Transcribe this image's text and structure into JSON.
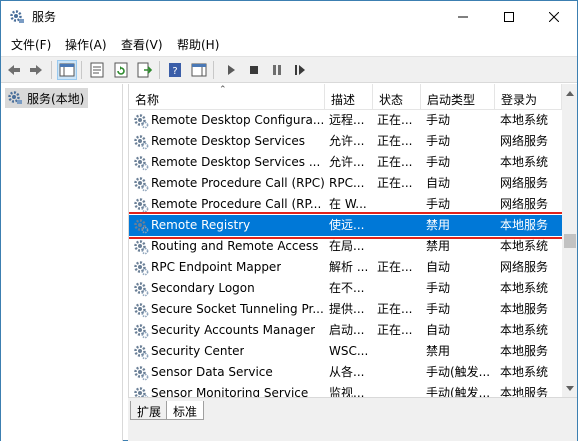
{
  "window": {
    "title": "服务",
    "icon": "gear-icon",
    "controls": [
      "minimize-icon",
      "maximize-icon",
      "close-icon"
    ]
  },
  "menu": {
    "file": "文件(F)",
    "action": "操作(A)",
    "view": "查看(V)",
    "help": "帮助(H)"
  },
  "toolbar": {
    "icons": [
      "back-arrow-icon",
      "forward-arrow-icon",
      "console-tree-icon",
      "properties-icon",
      "refresh-icon",
      "export-icon",
      "help-icon",
      "action-pane-icon",
      "start-service-icon",
      "stop-service-icon",
      "pause-service-icon",
      "restart-service-icon"
    ]
  },
  "tree": {
    "root_label": "服务(本地)"
  },
  "columns": {
    "name": "名称",
    "description": "描述",
    "status": "状态",
    "startup_type": "启动类型",
    "logon_as": "登录为"
  },
  "services": [
    {
      "name": "Remote Desktop Configura...",
      "description": "远程...",
      "status": "正在...",
      "startup_type": "手动",
      "logon_as": "本地系统"
    },
    {
      "name": "Remote Desktop Services",
      "description": "允许...",
      "status": "正在...",
      "startup_type": "手动",
      "logon_as": "网络服务"
    },
    {
      "name": "Remote Desktop Services ...",
      "description": "允许...",
      "status": "正在...",
      "startup_type": "手动",
      "logon_as": "本地系统"
    },
    {
      "name": "Remote Procedure Call (RPC)",
      "description": "RPC...",
      "status": "正在...",
      "startup_type": "自动",
      "logon_as": "网络服务"
    },
    {
      "name": "Remote Procedure Call (RP...",
      "description": "在 W...",
      "status": "",
      "startup_type": "手动",
      "logon_as": "网络服务"
    },
    {
      "name": "Remote Registry",
      "description": "使远...",
      "status": "",
      "startup_type": "禁用",
      "logon_as": "本地服务",
      "selected": true
    },
    {
      "name": "Routing and Remote Access",
      "description": "在局...",
      "status": "",
      "startup_type": "禁用",
      "logon_as": "本地系统"
    },
    {
      "name": "RPC Endpoint Mapper",
      "description": "解析 ...",
      "status": "正在...",
      "startup_type": "自动",
      "logon_as": "网络服务"
    },
    {
      "name": "Secondary Logon",
      "description": "在不...",
      "status": "",
      "startup_type": "手动",
      "logon_as": "本地系统"
    },
    {
      "name": "Secure Socket Tunneling Pr...",
      "description": "提供...",
      "status": "正在...",
      "startup_type": "手动",
      "logon_as": "本地服务"
    },
    {
      "name": "Security Accounts Manager",
      "description": "启动...",
      "status": "正在...",
      "startup_type": "自动",
      "logon_as": "本地系统"
    },
    {
      "name": "Security Center",
      "description": "WSC...",
      "status": "",
      "startup_type": "禁用",
      "logon_as": "本地服务"
    },
    {
      "name": "Sensor Data Service",
      "description": "从各...",
      "status": "",
      "startup_type": "手动(触发...",
      "logon_as": "本地系统"
    },
    {
      "name": "Sensor Monitoring Service",
      "description": "监视...",
      "status": "",
      "startup_type": "手动(触发...",
      "logon_as": "本地服务"
    }
  ],
  "tabs": {
    "extended": "扩展",
    "standard": "标准"
  }
}
